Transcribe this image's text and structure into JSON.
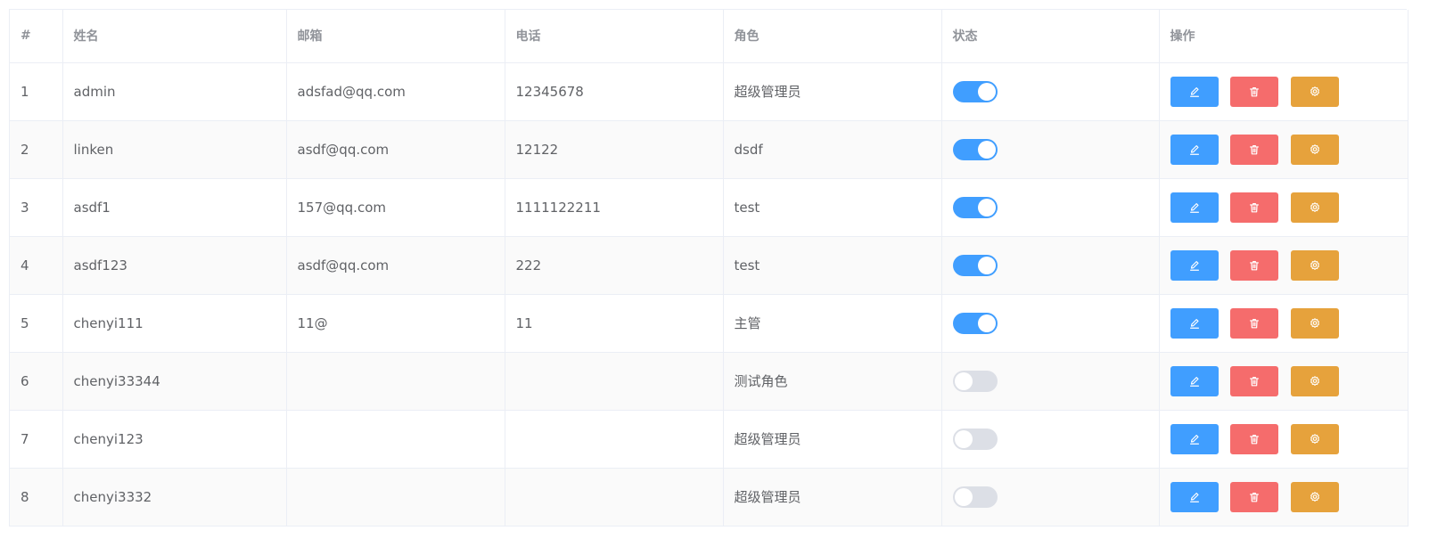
{
  "table": {
    "headers": [
      "#",
      "姓名",
      "邮箱",
      "电话",
      "角色",
      "状态",
      "操作"
    ],
    "rows": [
      {
        "index": "1",
        "name": "admin",
        "email": "adsfad@qq.com",
        "phone": "12345678",
        "role": "超级管理员",
        "status": true
      },
      {
        "index": "2",
        "name": "linken",
        "email": "asdf@qq.com",
        "phone": "12122",
        "role": "dsdf",
        "status": true
      },
      {
        "index": "3",
        "name": "asdf1",
        "email": "157@qq.com",
        "phone": "1111122211",
        "role": "test",
        "status": true
      },
      {
        "index": "4",
        "name": "asdf123",
        "email": "asdf@qq.com",
        "phone": "222",
        "role": "test",
        "status": true
      },
      {
        "index": "5",
        "name": "chenyi111",
        "email": "11@",
        "phone": "11",
        "role": "主管",
        "status": true
      },
      {
        "index": "6",
        "name": "chenyi33344",
        "email": "",
        "phone": "",
        "role": "测试角色",
        "status": false
      },
      {
        "index": "7",
        "name": "chenyi123",
        "email": "",
        "phone": "",
        "role": "超级管理员",
        "status": false
      },
      {
        "index": "8",
        "name": "chenyi3332",
        "email": "",
        "phone": "",
        "role": "超级管理员",
        "status": false
      }
    ],
    "actions": [
      {
        "name": "edit",
        "icon": "edit-icon",
        "color": "#409eff"
      },
      {
        "name": "delete",
        "icon": "delete-icon",
        "color": "#f56c6c"
      },
      {
        "name": "setting",
        "icon": "setting-icon",
        "color": "#e6a23c"
      }
    ]
  },
  "colors": {
    "switch_on": "#409eff",
    "switch_off": "#dcdfe6",
    "border": "#ebeef5",
    "stripe": "#fafafa"
  }
}
